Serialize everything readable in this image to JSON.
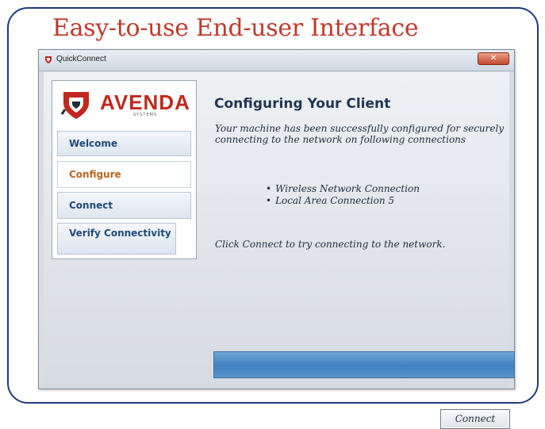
{
  "slide": {
    "title": "Easy-to-use End-user Interface"
  },
  "window": {
    "title": "QuickConnect",
    "close_label": "✕"
  },
  "logo": {
    "brand": "AVENDA",
    "sub": "SYSTEMS"
  },
  "nav": {
    "welcome": "Welcome",
    "configure": "Configure",
    "connect": "Connect",
    "verify": "Verify Connectivity"
  },
  "content": {
    "title": "Configuring Your Client",
    "message": "Your machine has been successfully configured for securely connecting to the network on following connections",
    "connections": [
      "Wireless Network Connection",
      "Local Area Connection 5"
    ],
    "instruction": "Click Connect to try connecting to the network."
  },
  "progress": {
    "value": 1.0
  },
  "buttons": {
    "connect": "Connect"
  },
  "colors": {
    "title_red": "#c0392b",
    "nav_blue": "#1e4a7a",
    "active_orange": "#b9651c",
    "progress_blue": "#3f80bf"
  },
  "icons": {
    "app": "shield-icon",
    "logo": "avenda-logo-icon"
  }
}
